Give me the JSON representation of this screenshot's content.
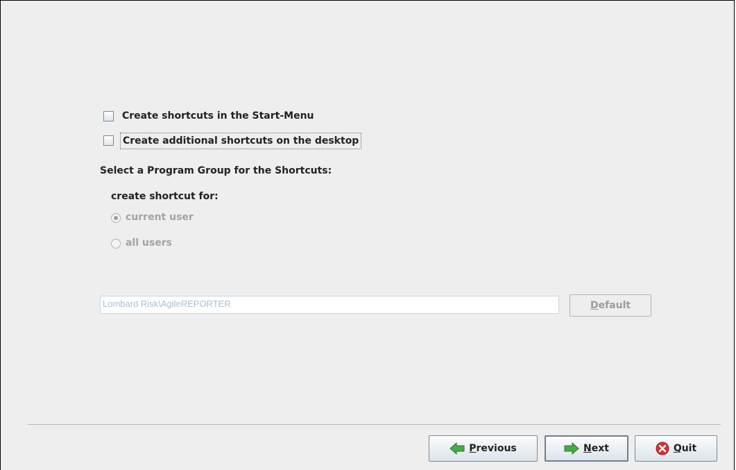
{
  "options": {
    "start_menu_label": "Create shortcuts in the Start-Menu",
    "desktop_label": "Create additional shortcuts on the desktop"
  },
  "program_group": {
    "heading": "Select a Program Group for the Shortcuts:",
    "shortcut_for_label": "create shortcut for:",
    "radio_current_user": "current user",
    "radio_all_users": "all users",
    "group_path_value": "Lombard Risk\\AgileREPORTER",
    "default_button_mnemonic": "D",
    "default_button_rest": "efault"
  },
  "footer": {
    "previous_mnemonic": "P",
    "previous_rest": "revious",
    "next_mnemonic": "N",
    "next_rest": "ext",
    "quit_mnemonic": "Q",
    "quit_rest": "uit"
  },
  "colors": {
    "panel_bg": "#eeeeee",
    "disabled_text": "#a3a3a3",
    "arrow_green": "#3fa63f",
    "quit_red": "#cc2b2b"
  }
}
